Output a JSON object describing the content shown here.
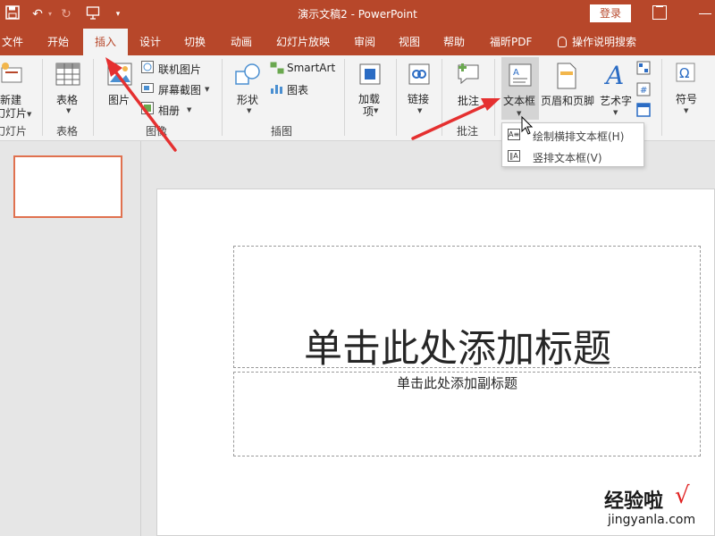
{
  "titlebar": {
    "title": "演示文稿2  -  PowerPoint",
    "login_label": "登录"
  },
  "tabs": [
    {
      "label": "文件"
    },
    {
      "label": "开始"
    },
    {
      "label": "插入"
    },
    {
      "label": "设计"
    },
    {
      "label": "切换"
    },
    {
      "label": "动画"
    },
    {
      "label": "幻灯片放映"
    },
    {
      "label": "审阅"
    },
    {
      "label": "视图"
    },
    {
      "label": "帮助"
    },
    {
      "label": "福昕PDF"
    },
    {
      "label": "操作说明搜索"
    }
  ],
  "active_tab": "插入",
  "ribbon": {
    "new_slide": {
      "label_line1": "新建",
      "label_line2": "幻灯片"
    },
    "slides_group": "幻灯片",
    "table": {
      "label": "表格"
    },
    "tables_group": "表格",
    "pictures": {
      "label": "图片"
    },
    "online_pictures": "联机图片",
    "screenshot": "屏幕截图",
    "album": "相册",
    "images_group": "图像",
    "shapes": {
      "label": "形状"
    },
    "smartart": "SmartArt",
    "chart": "图表",
    "illustrations_group": "插图",
    "addins": {
      "label_line1": "加载",
      "label_line2": "项"
    },
    "links": {
      "label": "链接"
    },
    "comment": {
      "label": "批注"
    },
    "comments_group": "批注",
    "textbox": {
      "label": "文本框"
    },
    "header_footer": {
      "label": "页眉和页脚"
    },
    "wordart": {
      "label": "艺术字"
    },
    "symbol": {
      "label": "符号"
    }
  },
  "textbox_menu": [
    {
      "label": "绘制横排文本框(H)"
    },
    {
      "label": "竖排文本框(V)"
    }
  ],
  "slide": {
    "title_placeholder": "单击此处添加标题",
    "subtitle_placeholder": "单击此处添加副标题"
  },
  "watermark": {
    "line1": "经验啦",
    "check": "√",
    "line2": "jingyanla.com"
  },
  "colors": {
    "accent": "#b7472a",
    "arrow": "#e53030",
    "thumb_border": "#e0714f"
  }
}
